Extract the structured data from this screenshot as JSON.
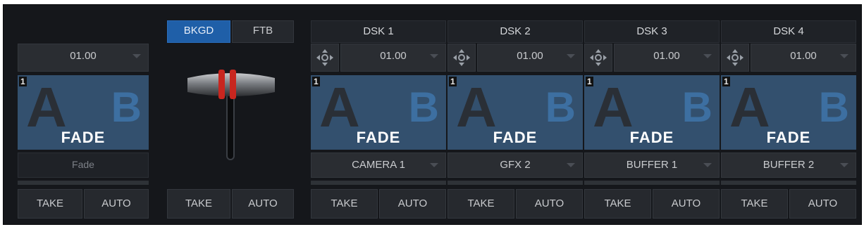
{
  "left": {
    "duration": "01.00",
    "number": "1",
    "letter_a": "A",
    "letter_b": "B",
    "transition": "FADE",
    "label": "Fade",
    "take": "TAKE",
    "auto": "AUTO"
  },
  "master": {
    "tab_bkgd": "BKGD",
    "tab_ftb": "FTB",
    "take": "TAKE",
    "auto": "AUTO"
  },
  "dsk": [
    {
      "title": "DSK 1",
      "duration": "01.00",
      "number": "1",
      "letter_a": "A",
      "letter_b": "B",
      "transition": "FADE",
      "source": "CAMERA 1",
      "take": "TAKE",
      "auto": "AUTO"
    },
    {
      "title": "DSK 2",
      "duration": "01.00",
      "number": "1",
      "letter_a": "A",
      "letter_b": "B",
      "transition": "FADE",
      "source": "GFX 2",
      "take": "TAKE",
      "auto": "AUTO"
    },
    {
      "title": "DSK 3",
      "duration": "01.00",
      "number": "1",
      "letter_a": "A",
      "letter_b": "B",
      "transition": "FADE",
      "source": "BUFFER 1",
      "take": "TAKE",
      "auto": "AUTO"
    },
    {
      "title": "DSK 4",
      "duration": "01.00",
      "number": "1",
      "letter_a": "A",
      "letter_b": "B",
      "transition": "FADE",
      "source": "BUFFER 2",
      "take": "TAKE",
      "auto": "AUTO"
    }
  ],
  "icons": {
    "move": "move-arrows-icon",
    "caret": "chevron-down-icon"
  },
  "colors": {
    "panel_bg": "#15171b",
    "active_tab": "#1f5fa8",
    "thumb_bg": "#33506e",
    "tbar_red": "#c8261f"
  }
}
